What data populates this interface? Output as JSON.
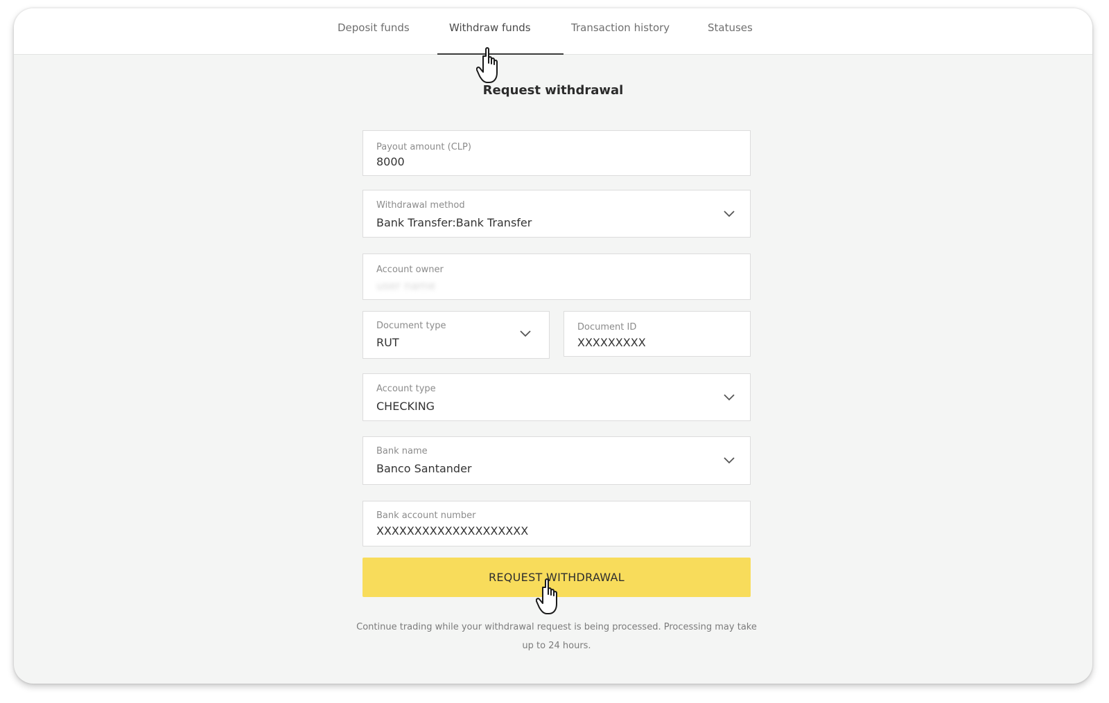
{
  "nav": {
    "tabs": [
      {
        "label": "Deposit funds"
      },
      {
        "label": "Withdraw funds",
        "active": true
      },
      {
        "label": "Transaction history"
      },
      {
        "label": "Statuses"
      }
    ]
  },
  "form": {
    "title": "Request withdrawal",
    "payout_amount": {
      "label": "Payout amount (CLP)",
      "value": "8000"
    },
    "withdrawal_method": {
      "label": "Withdrawal method",
      "value": "Bank Transfer:Bank Transfer",
      "icon": "chevron-down-icon"
    },
    "account_owner": {
      "label": "Account owner",
      "value": "user name"
    },
    "document_type": {
      "label": "Document type",
      "value": "RUT",
      "icon": "chevron-down-icon"
    },
    "document_id": {
      "label": "Document ID",
      "value": "XXXXXXXXX"
    },
    "account_type": {
      "label": "Account type",
      "value": "CHECKING",
      "icon": "chevron-down-icon"
    },
    "bank_name": {
      "label": "Bank name",
      "value": "Banco Santander",
      "icon": "chevron-down-icon"
    },
    "bank_account_number": {
      "label": "Bank account number",
      "value": "XXXXXXXXXXXXXXXXXXXX"
    },
    "submit_label": "REQUEST WITHDRAWAL",
    "note": "Continue trading while your withdrawal request is being processed.  Processing may take up to 24 hours."
  },
  "colors": {
    "accent_button": "#f8dc5b",
    "page_background": "#f4f5f4",
    "active_tab_underline": "#3b3b3b"
  },
  "icons": [
    "chevron-down-icon",
    "hand-pointer-cursor-icon"
  ]
}
